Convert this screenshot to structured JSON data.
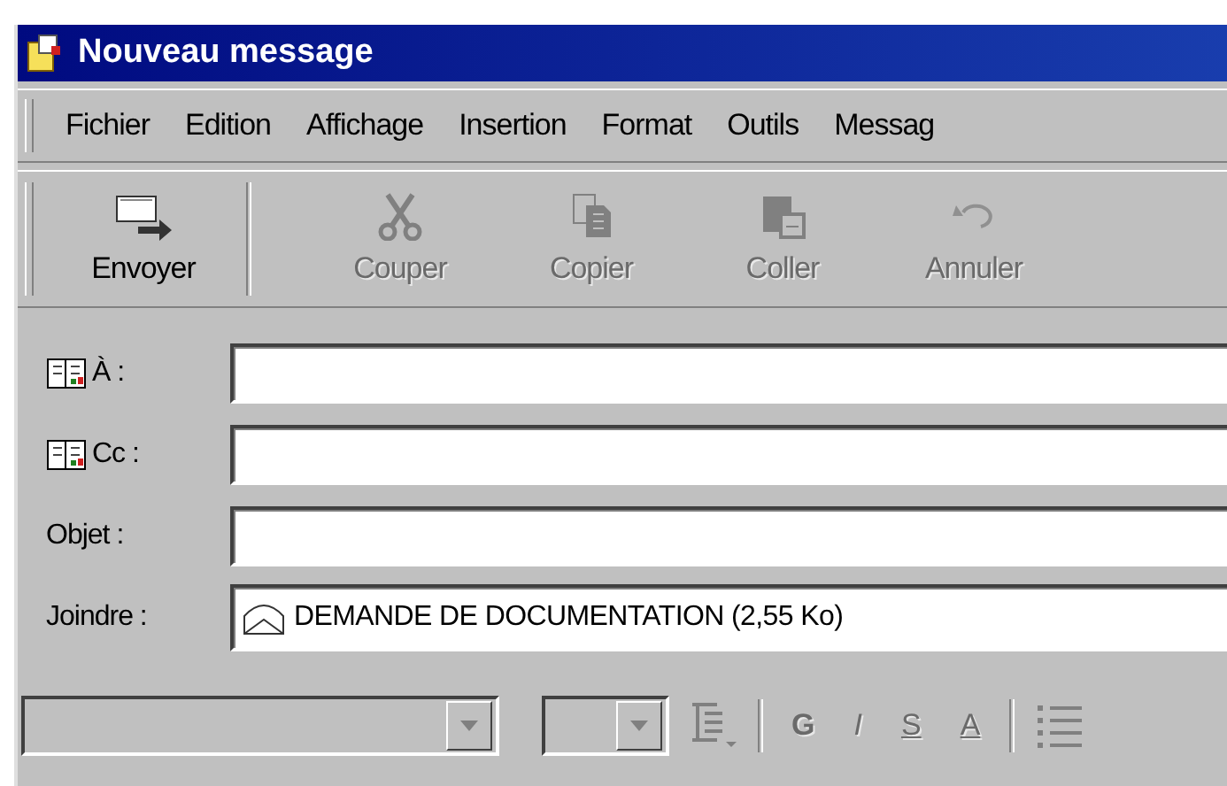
{
  "window": {
    "title": "Nouveau message"
  },
  "menu": [
    {
      "label": "Fichier"
    },
    {
      "label": "Edition"
    },
    {
      "label": "Affichage"
    },
    {
      "label": "Insertion"
    },
    {
      "label": "Format"
    },
    {
      "label": "Outils"
    },
    {
      "label": "Messag"
    }
  ],
  "toolbar": [
    {
      "label": "Envoyer",
      "kind": "send",
      "disabled": false
    },
    {
      "label": "Couper",
      "kind": "cut",
      "disabled": true
    },
    {
      "label": "Copier",
      "kind": "copy",
      "disabled": true
    },
    {
      "label": "Coller",
      "kind": "paste",
      "disabled": true
    },
    {
      "label": "Annuler",
      "kind": "undo",
      "disabled": true
    }
  ],
  "fields": [
    {
      "label": "À :",
      "kind": "address"
    },
    {
      "label": "Cc :",
      "kind": "address"
    },
    {
      "label": "Objet :",
      "kind": "text"
    },
    {
      "label": "Joindre :",
      "kind": "attachment",
      "value": "DEMANDE DE DOCUMENTATION (2,55 Ko)"
    }
  ],
  "format_bar": {
    "buttons": [
      {
        "label": "G",
        "kind": "bold"
      },
      {
        "label": "I",
        "kind": "italic"
      },
      {
        "label": "S",
        "kind": "underline"
      },
      {
        "label": "A",
        "kind": "color"
      }
    ]
  }
}
